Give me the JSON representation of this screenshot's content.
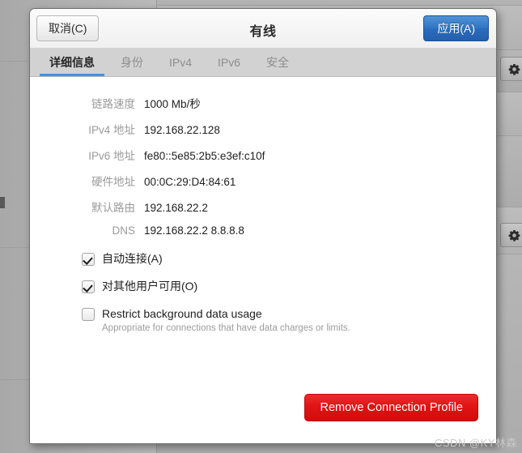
{
  "dialog": {
    "title": "有线",
    "cancel_label": "取消(C)",
    "apply_label": "应用(A)",
    "tabs": [
      {
        "label": "详细信息",
        "active": true
      },
      {
        "label": "身份",
        "active": false
      },
      {
        "label": "IPv4",
        "active": false
      },
      {
        "label": "IPv6",
        "active": false
      },
      {
        "label": "安全",
        "active": false
      }
    ],
    "details": [
      {
        "label": "链路速度",
        "value": "1000 Mb/秒"
      },
      {
        "label": "IPv4 地址",
        "value": "192.168.22.128"
      },
      {
        "label": "IPv6 地址",
        "value": "fe80::5e85:2b5:e3ef:c10f"
      },
      {
        "label": "硬件地址",
        "value": "00:0C:29:D4:84:61"
      },
      {
        "label": "默认路由",
        "value": "192.168.22.2"
      },
      {
        "label": "DNS",
        "value": "192.168.22.2 8.8.8.8"
      }
    ],
    "options": [
      {
        "label": "自动连接(A)",
        "checked": true,
        "sub": ""
      },
      {
        "label": "对其他用户可用(O)",
        "checked": true,
        "sub": ""
      },
      {
        "label": "Restrict background data usage",
        "checked": false,
        "sub": "Appropriate for connections that have data charges or limits."
      }
    ],
    "remove_label": "Remove Connection Profile"
  },
  "background": {
    "gear_icon_name": "gear-icon"
  },
  "watermark": "CSDN @KY林森",
  "colors": {
    "accent_blue": "#4a90d9",
    "apply_blue": "#2f74c4",
    "danger_red": "#e01414",
    "label_gray": "#9a9a9a"
  }
}
